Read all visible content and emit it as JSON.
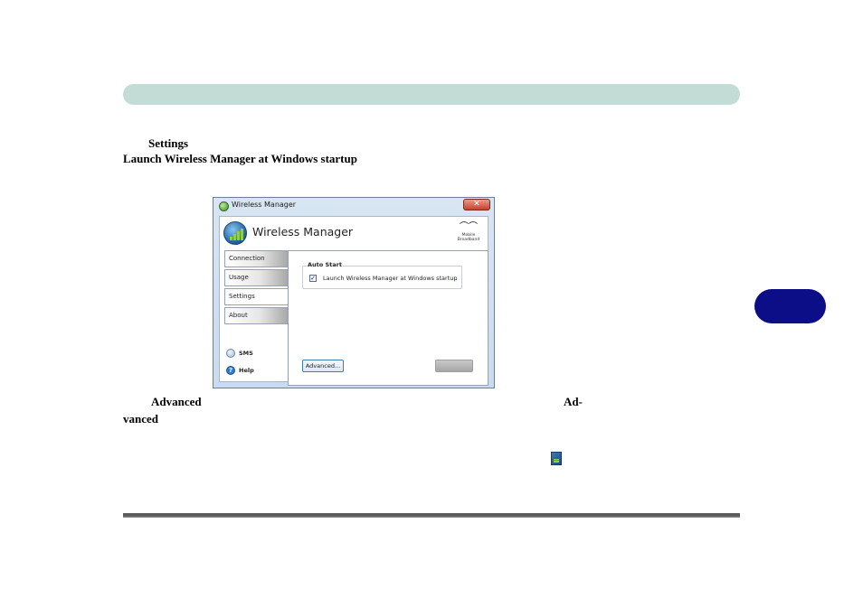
{
  "document": {
    "heading_settings": "Settings",
    "heading_launch": "Launch Wireless Manager at Windows startup",
    "bottom_advanced": "Advanced",
    "bottom_ad": "Ad-",
    "bottom_vanced": "vanced"
  },
  "window": {
    "title": "Wireless Manager",
    "close_glyph": "✕",
    "app_title": "Wireless Manager",
    "brand_line1": "Mobile",
    "brand_line2": "Broadband",
    "nav": [
      {
        "label": "Connection"
      },
      {
        "label": "Usage"
      },
      {
        "label": "Settings"
      },
      {
        "label": "About"
      }
    ],
    "active_nav": "Settings",
    "auto_start": {
      "group_label": "Auto Start",
      "checkbox_label": "Launch Wireless Manager at Windows startup",
      "checked": true,
      "check_glyph": "✓"
    },
    "advanced_button": "Advanced...",
    "sms_label": "SMS",
    "help_label": "Help",
    "help_glyph": "?"
  },
  "colors": {
    "top_bar": "#c4dcd6",
    "chapter_tab": "#0c0e88",
    "window_frame": "#c9dbee"
  },
  "icons": {
    "tray_icon": "wireless-manager-tray-icon",
    "app_logo": "wireless-signal-globe-icon"
  }
}
